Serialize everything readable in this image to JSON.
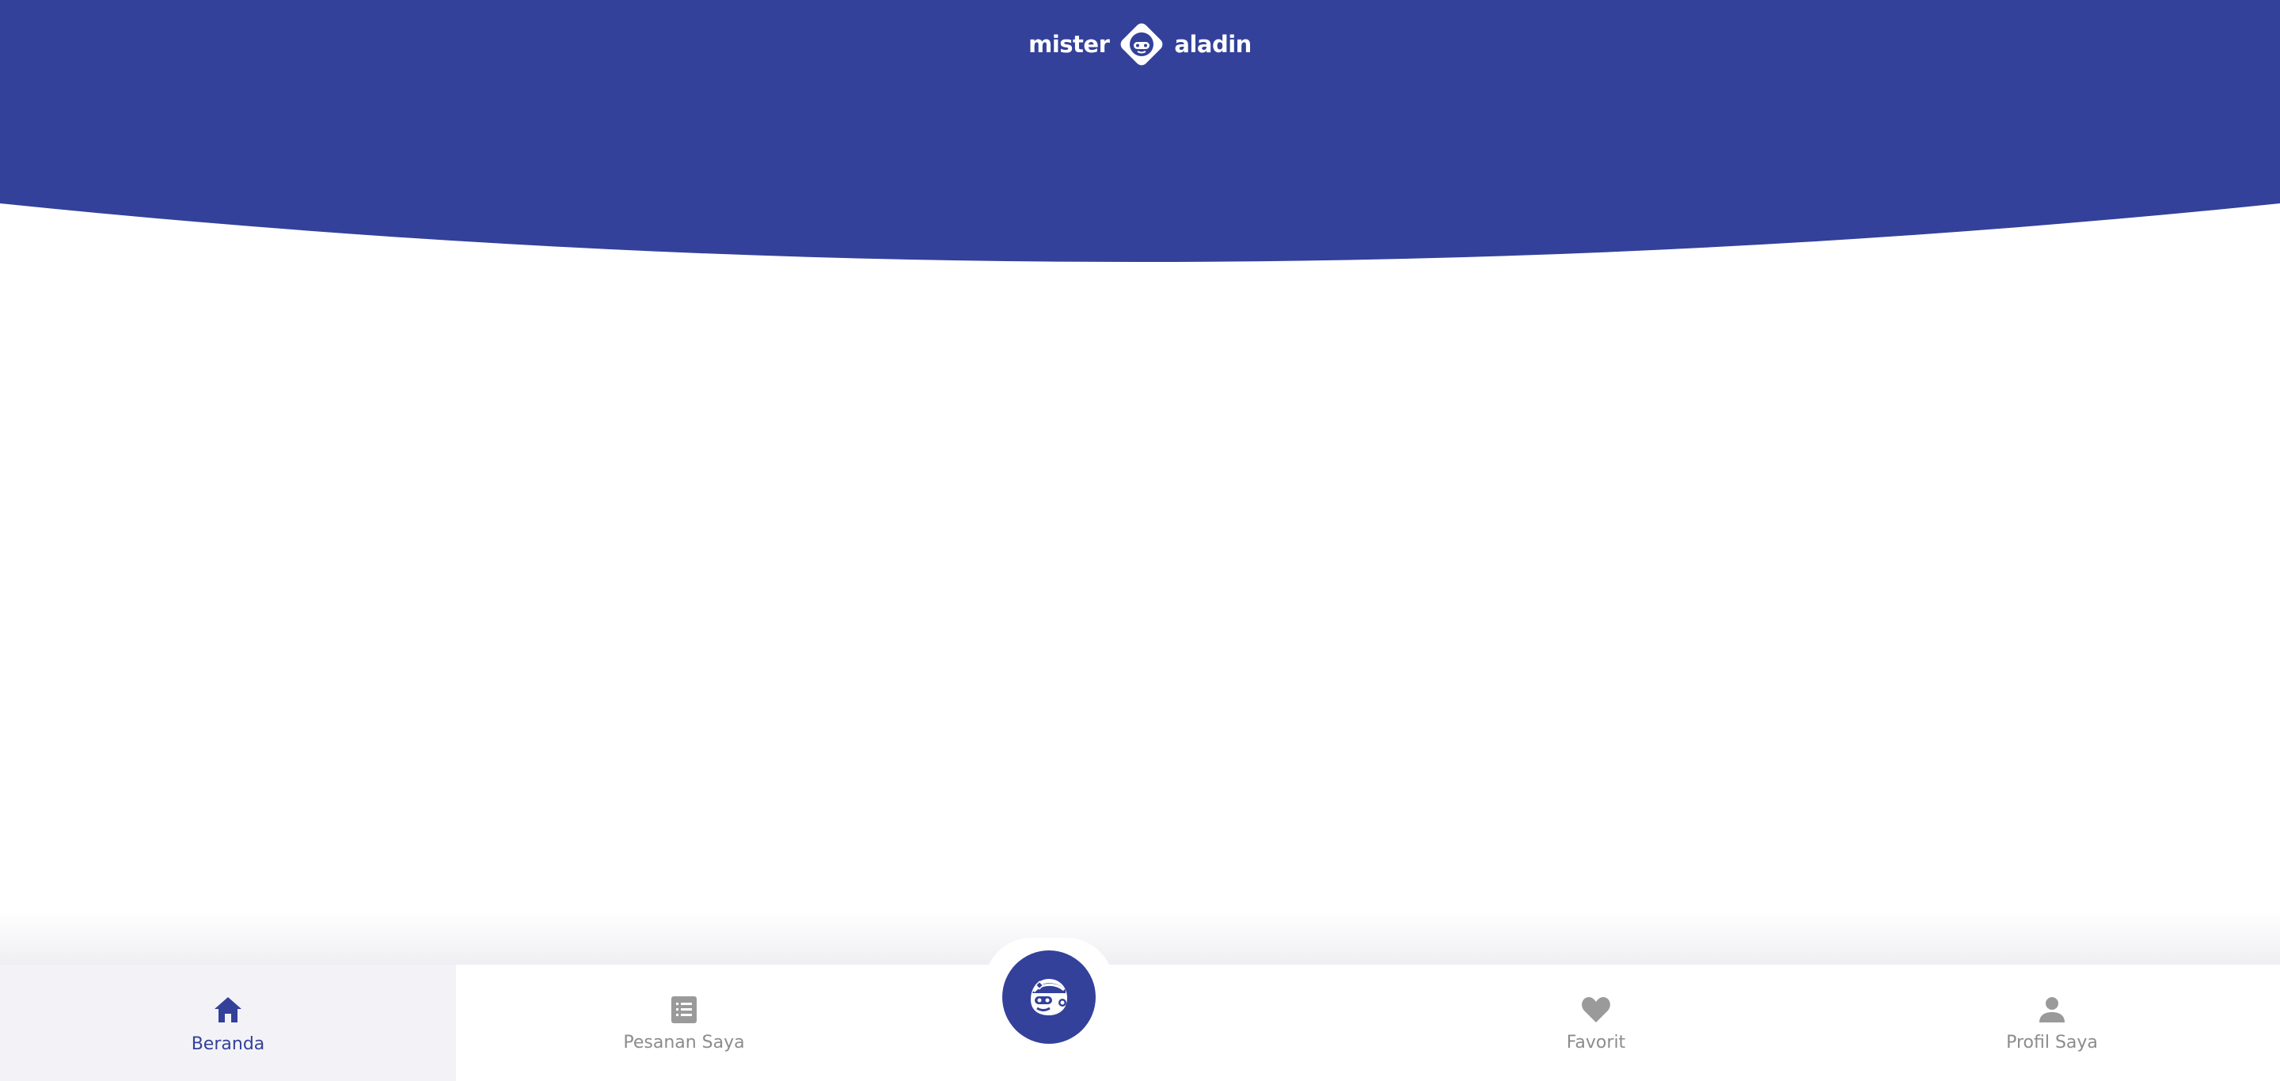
{
  "colors": {
    "brand": "#33419a",
    "active_label": "#34419a",
    "inactive": "#8c8c8c",
    "active_bg": "#f3f3f7",
    "background": "#ffffff"
  },
  "header": {
    "logo": {
      "left_text": "mister",
      "right_text": "aladin",
      "mark_icon": "genie-face-diamond"
    }
  },
  "bottom_nav": {
    "items": [
      {
        "label": "Beranda",
        "icon": "home-icon",
        "active": true
      },
      {
        "label": "Pesanan Saya",
        "icon": "order-list-icon",
        "active": false
      },
      {
        "label": "",
        "icon": "genie-assistant-icon",
        "active": false
      },
      {
        "label": "Favorit",
        "icon": "heart-icon",
        "active": false
      },
      {
        "label": "Profil Saya",
        "icon": "person-icon",
        "active": false
      }
    ]
  }
}
